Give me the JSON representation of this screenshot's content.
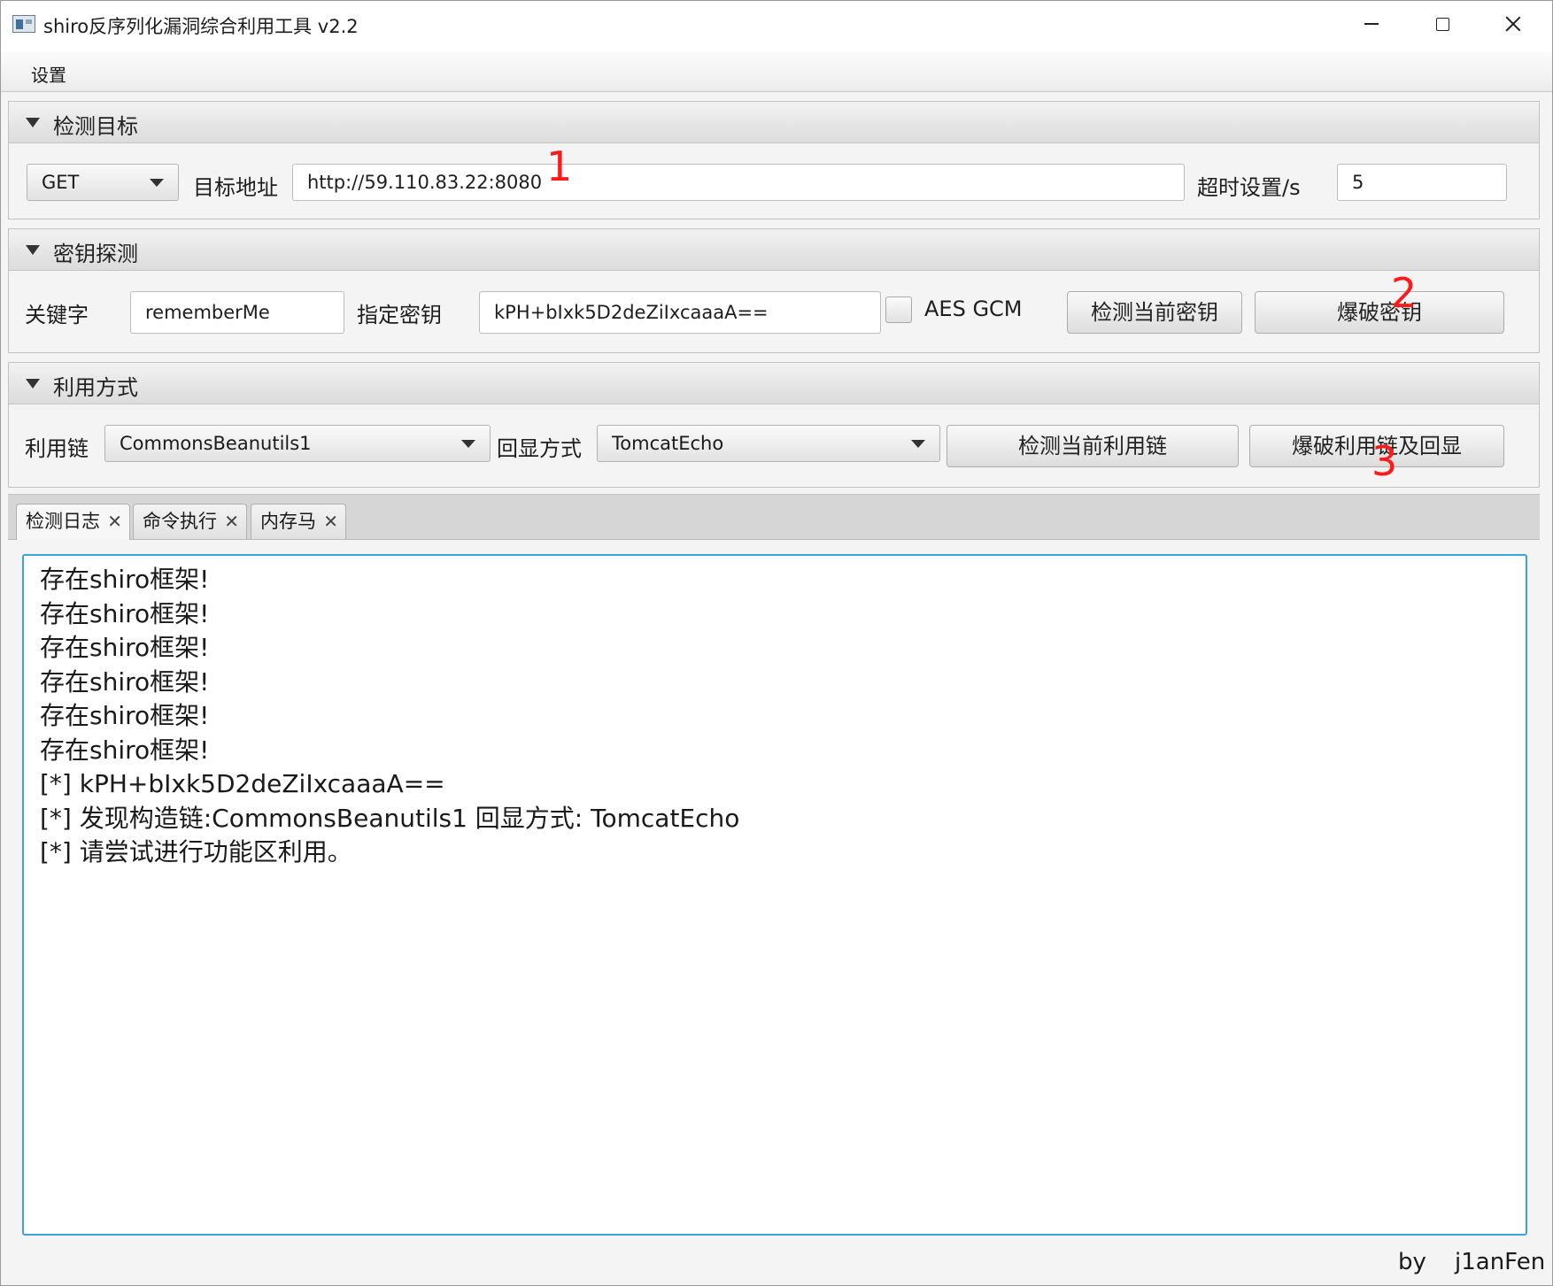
{
  "window": {
    "title": "shiro反序列化漏洞综合利用工具 v2.2"
  },
  "menu": {
    "items": [
      "设置"
    ]
  },
  "target_pane": {
    "title": "检测目标",
    "method": "GET",
    "url_label": "目标地址",
    "url_value": "http://59.110.83.22:8080",
    "timeout_label": "超时设置/s",
    "timeout_value": "5"
  },
  "key_pane": {
    "title": "密钥探测",
    "keyword_label": "关键字",
    "keyword_value": "rememberMe",
    "key_label": "指定密钥",
    "key_value": "kPH+bIxk5D2deZiIxcaaaA==",
    "aes_gcm_label": "AES GCM",
    "aes_gcm_checked": false,
    "check_key_button": "检测当前密钥",
    "brute_key_button": "爆破密钥"
  },
  "exploit_pane": {
    "title": "利用方式",
    "chain_label": "利用链",
    "chain_value": "CommonsBeanutils1",
    "echo_label": "回显方式",
    "echo_value": "TomcatEcho",
    "check_chain_button": "检测当前利用链",
    "brute_chain_button": "爆破利用链及回显"
  },
  "tabs": [
    {
      "label": "检测日志",
      "active": true
    },
    {
      "label": "命令执行",
      "active": false
    },
    {
      "label": "内存马",
      "active": false
    }
  ],
  "log": [
    "存在shiro框架!",
    "存在shiro框架!",
    "存在shiro框架!",
    "存在shiro框架!",
    "存在shiro框架!",
    "存在shiro框架!",
    "[*] kPH+bIxk5D2deZiIxcaaaA==",
    "[*] 发现构造链:CommonsBeanutils1  回显方式: TomcatEcho",
    "[*] 请尝试进行功能区利用。"
  ],
  "footer": {
    "by": "by",
    "author": "j1anFen"
  },
  "annotations": [
    "1",
    "2",
    "3"
  ],
  "colors": {
    "annotation": "#ff1a1a",
    "focus_border": "#3aa3dc"
  }
}
